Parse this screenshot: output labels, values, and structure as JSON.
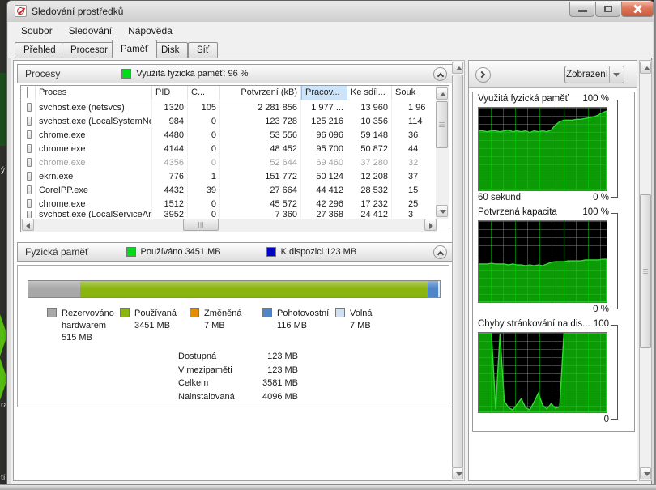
{
  "window": {
    "title": "Sledování prostředků"
  },
  "menu": {
    "items": [
      "Soubor",
      "Sledování",
      "Nápověda"
    ]
  },
  "tabs": {
    "items": [
      "Přehled",
      "Procesor",
      "Paměť",
      "Disk",
      "Síť"
    ],
    "active": "Paměť"
  },
  "processes": {
    "title": "Procesy",
    "status_label": "Využitá fyzická paměť: 96 %",
    "status_color": "#00dc19",
    "columns": {
      "name": "Proces",
      "pid": "PID",
      "cpu": "C...",
      "commit": "Potvrzení (kB)",
      "working": "Pracov...",
      "shareable": "Ke sdíl...",
      "private": "Souk"
    },
    "rows": [
      {
        "name": "svchost.exe (netsvcs)",
        "pid": "1320",
        "cpu": "105",
        "commit": "2 281 856",
        "working": "1 977 ...",
        "shareable": "13 960",
        "private": "1 96",
        "dimmed": false,
        "partial": false
      },
      {
        "name": "svchost.exe (LocalSystemNet...",
        "pid": "984",
        "cpu": "0",
        "commit": "123 728",
        "working": "125 216",
        "shareable": "10 356",
        "private": "114",
        "dimmed": false,
        "partial": false
      },
      {
        "name": "chrome.exe",
        "pid": "4480",
        "cpu": "0",
        "commit": "53 556",
        "working": "96 096",
        "shareable": "59 148",
        "private": "36",
        "dimmed": false,
        "partial": false
      },
      {
        "name": "chrome.exe",
        "pid": "4144",
        "cpu": "0",
        "commit": "48 452",
        "working": "95 700",
        "shareable": "50 872",
        "private": "44",
        "dimmed": false,
        "partial": false
      },
      {
        "name": "chrome.exe",
        "pid": "4356",
        "cpu": "0",
        "commit": "52 644",
        "working": "69 460",
        "shareable": "37 280",
        "private": "32",
        "dimmed": true,
        "partial": false
      },
      {
        "name": "ekrn.exe",
        "pid": "776",
        "cpu": "1",
        "commit": "151 772",
        "working": "50 124",
        "shareable": "12 208",
        "private": "37",
        "dimmed": false,
        "partial": false
      },
      {
        "name": "CoreIPP.exe",
        "pid": "4432",
        "cpu": "39",
        "commit": "27 664",
        "working": "44 412",
        "shareable": "28 532",
        "private": "15",
        "dimmed": false,
        "partial": false
      },
      {
        "name": "chrome.exe",
        "pid": "1512",
        "cpu": "0",
        "commit": "45 572",
        "working": "42 296",
        "shareable": "17 232",
        "private": "25",
        "dimmed": false,
        "partial": false
      },
      {
        "name": "svchost.exe (LocalServiceAn...",
        "pid": "3952",
        "cpu": "0",
        "commit": "7 360",
        "working": "27 368",
        "shareable": "24 412",
        "private": "3",
        "dimmed": false,
        "partial": true
      }
    ]
  },
  "memory": {
    "title": "Fyzická paměť",
    "used": {
      "label": "Používáno 3451 MB",
      "color": "#00dc19"
    },
    "available": {
      "label": "K dispozici 123 MB",
      "color": "#0000c8"
    },
    "bar_segments": [
      {
        "name": "Rezervováno hardwarem",
        "color": "#a8a8a8",
        "pct": 12.6
      },
      {
        "name": "Používaná",
        "color": "#8ab40e",
        "pct": 84.2
      },
      {
        "name": "Změněná",
        "color": "#e68c00",
        "pct": 0.3
      },
      {
        "name": "Pohotovostní",
        "color": "#4e86c8",
        "pct": 2.6
      },
      {
        "name": "Volná",
        "color": "#d6e6f5",
        "pct": 0.3
      }
    ],
    "legend": [
      {
        "color": "#a8a8a8",
        "lines": [
          "Rezervováno",
          "hardwarem",
          "515 MB"
        ]
      },
      {
        "color": "#8ab40e",
        "lines": [
          "Používaná",
          "3451 MB",
          ""
        ]
      },
      {
        "color": "#e68c00",
        "lines": [
          "Změněná",
          "7 MB",
          ""
        ]
      },
      {
        "color": "#4e86c8",
        "lines": [
          "Pohotovostní",
          "116 MB",
          ""
        ]
      },
      {
        "color": "#cfe0f2",
        "lines": [
          "Volná",
          "7 MB",
          ""
        ]
      }
    ],
    "stats": [
      {
        "label": "Dostupná",
        "value": "123 MB"
      },
      {
        "label": "V mezipaměti",
        "value": "123 MB"
      },
      {
        "label": "Celkem",
        "value": "3581 MB"
      },
      {
        "label": "Nainstalovaná",
        "value": "4096 MB"
      }
    ]
  },
  "right_panel": {
    "views_button": "Zobrazení",
    "graph_colors": {
      "fill": "#0c9a06",
      "line": "#35dc35",
      "bg": "#000000"
    },
    "graphs": [
      {
        "title": "Využitá fyzická paměť",
        "scale_top": "100 %",
        "scale_bottom": "0 %",
        "time_label": "60 sekund",
        "points": [
          72,
          72,
          71,
          72,
          72,
          71,
          72,
          73,
          71,
          72,
          71,
          72,
          70,
          72,
          71,
          72,
          71,
          73,
          79,
          83,
          85,
          85,
          85,
          86,
          86,
          87,
          88,
          89,
          91,
          94,
          96
        ]
      },
      {
        "title": "Potvrzená kapacita",
        "scale_top": "100 %",
        "scale_bottom": "0 %",
        "time_label": "",
        "points": [
          47,
          47,
          47,
          48,
          47,
          47,
          47,
          46,
          47,
          46,
          46,
          45,
          46,
          45,
          46,
          45,
          47,
          49,
          50,
          50,
          50,
          51,
          51,
          51,
          51,
          52,
          52,
          52,
          52,
          53,
          53
        ]
      },
      {
        "title": "Chyby stránkování na dis...",
        "scale_top": "100",
        "scale_bottom": "0",
        "time_label": "",
        "points": [
          100,
          100,
          100,
          100,
          4,
          99,
          14,
          6,
          3,
          10,
          17,
          6,
          3,
          13,
          24,
          9,
          4,
          11,
          5,
          7,
          100,
          100,
          100,
          100,
          100,
          100,
          100,
          100,
          100,
          100,
          100
        ]
      }
    ]
  },
  "desktop": {
    "fragments": [
      "ý",
      "ra",
      "tí"
    ]
  }
}
